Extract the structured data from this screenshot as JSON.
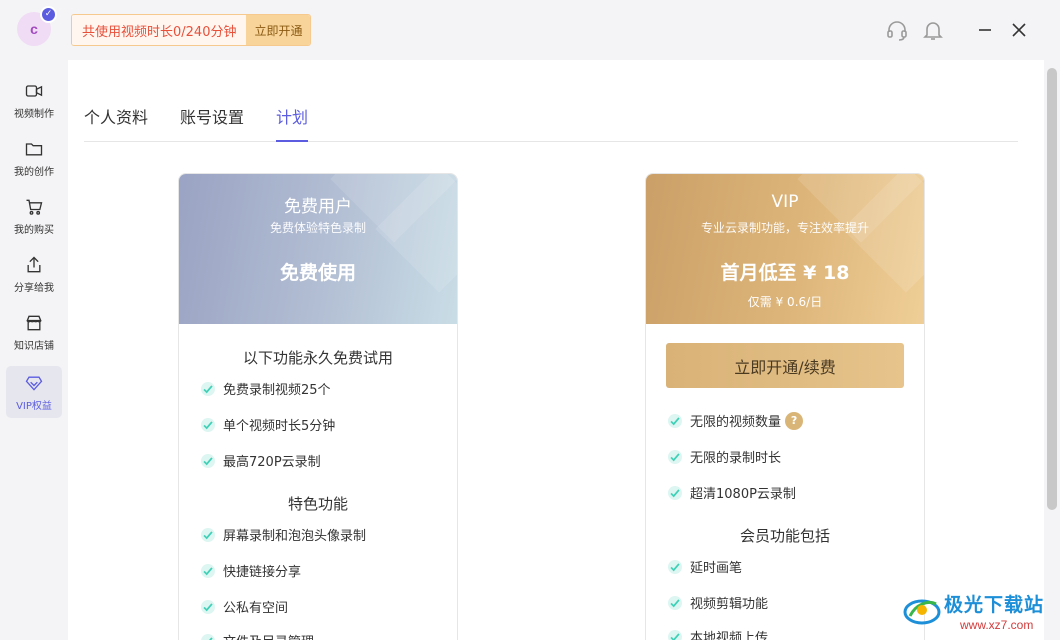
{
  "header": {
    "avatar_letter": "c",
    "usage_text": "共使用视频时长0/240分钟",
    "open_now": "立即开通"
  },
  "sidebar": {
    "items": [
      {
        "label": "视频制作",
        "icon": "video-camera-icon"
      },
      {
        "label": "我的创作",
        "icon": "folder-icon"
      },
      {
        "label": "我的购买",
        "icon": "shopping-cart-icon"
      },
      {
        "label": "分享给我",
        "icon": "share-icon"
      },
      {
        "label": "知识店铺",
        "icon": "store-icon"
      },
      {
        "label": "VIP权益",
        "icon": "diamond-icon",
        "active": true
      }
    ]
  },
  "tabs": [
    {
      "label": "个人资料",
      "active": false
    },
    {
      "label": "账号设置",
      "active": false
    },
    {
      "label": "计划",
      "active": true
    }
  ],
  "free_card": {
    "title": "免费用户",
    "subtitle": "免费体验特色录制",
    "price": "免费使用",
    "section1_title": "以下功能永久免费试用",
    "section1_items": [
      "免费录制视频25个",
      "单个视频时长5分钟",
      "最高720P云录制"
    ],
    "section2_title": "特色功能",
    "section2_items": [
      "屏幕录制和泡泡头像录制",
      "快捷链接分享",
      "公私有空间",
      "文件及目录管理"
    ]
  },
  "vip_card": {
    "title": "VIP",
    "subtitle": "专业云录制功能，专注效率提升",
    "price": "首月低至 ¥ 18",
    "daily": "仅需 ¥ 0.6/日",
    "button": "立即开通/续费",
    "section1_items": [
      "无限的视频数量",
      "无限的录制时长",
      "超清1080P云录制"
    ],
    "help_mark": "?",
    "section2_title": "会员功能包括",
    "section2_items": [
      "延时画笔",
      "视频剪辑功能",
      "本地视频上传"
    ]
  },
  "watermark": {
    "text": "极光下载站",
    "url": "www.xz7.com"
  },
  "colors": {
    "accent": "#5b5ce0",
    "check": "#3fd0b8",
    "vip_gold": "#d9b277",
    "usage_red": "#e8503a"
  }
}
